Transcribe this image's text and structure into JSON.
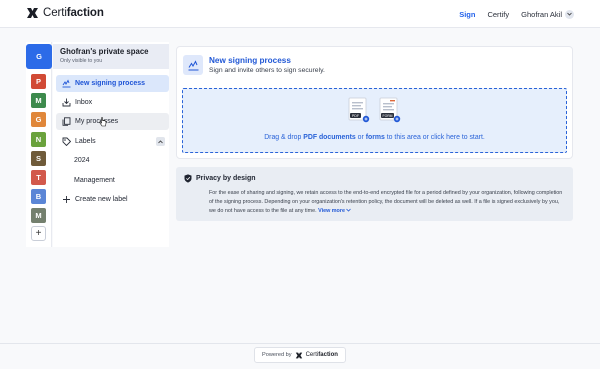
{
  "app": {
    "brand_prefix": "Certi",
    "brand_suffix": "faction"
  },
  "nav": {
    "sign": "Sign",
    "certify": "Certify",
    "user": "Ghofran Akil"
  },
  "spaces": [
    {
      "letter": "G",
      "color": "#2c6be8",
      "active": true
    },
    {
      "letter": "P",
      "color": "#d14a35"
    },
    {
      "letter": "M",
      "color": "#3d8a4c"
    },
    {
      "letter": "G",
      "color": "#e0873a"
    },
    {
      "letter": "N",
      "color": "#6aa23c"
    },
    {
      "letter": "S",
      "color": "#6f5b3a"
    },
    {
      "letter": "T",
      "color": "#d2594c"
    },
    {
      "letter": "B",
      "color": "#5b86d6"
    },
    {
      "letter": "M",
      "color": "#74806e"
    }
  ],
  "sidebar": {
    "space_name": "Ghofran's private space",
    "space_sub": "Only visible to you",
    "new_signing": "New signing process",
    "inbox": "Inbox",
    "my_processes": "My processes",
    "labels": "Labels",
    "label_items": [
      "2024",
      "Management"
    ],
    "create_label": "Create new label"
  },
  "card": {
    "title": "New signing process",
    "subtitle": "Sign and invite others to sign securely.",
    "dz_part1": "Drag & drop ",
    "dz_pdf": "PDF documents",
    "dz_part2": " or ",
    "dz_forms": "forms",
    "dz_part3": " to this area or click here to start.",
    "file1_badge": "PDF",
    "file2_badge": "FORM"
  },
  "privacy": {
    "title": "Privacy by design",
    "body": "For the ease of sharing and signing, we retain access to the end-to-end encrypted file for a period defined by your organization, following completion of the signing process. Depending on your organization's retention policy, the document will be deleted as well. If a file is signed exclusively by you, we do not have access to the file at any time.",
    "view_more": "View more"
  },
  "footer": {
    "powered_by": "Powered by",
    "brand_prefix": "Certi",
    "brand_suffix": "faction"
  },
  "colors": {
    "accent": "#2158d6",
    "dropzone_bg": "#e6effc",
    "active_item_bg": "#dbe7fb"
  }
}
